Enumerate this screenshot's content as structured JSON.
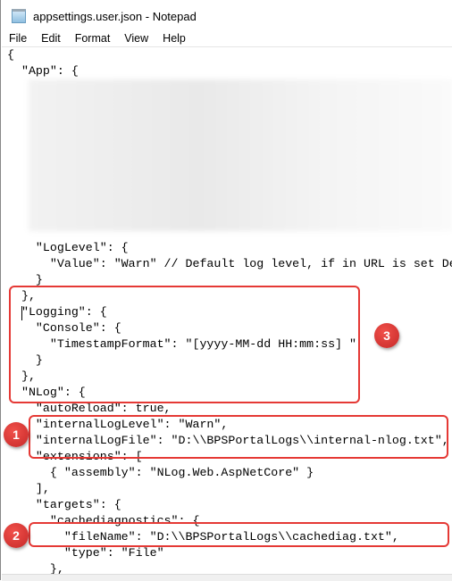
{
  "window": {
    "title": "appsettings.user.json - Notepad",
    "icon": "notepad-icon"
  },
  "menu": [
    "File",
    "Edit",
    "Format",
    "View",
    "Help"
  ],
  "lines": [
    "{",
    "  \"App\": {",
    "    \"LogLevel\": {",
    "      \"Value\": \"Warn\" // Default log level, if in URL is set De",
    "    }",
    "  },",
    "  \"Logging\": {",
    "    \"Console\": {",
    "      \"TimestampFormat\": \"[yyyy-MM-dd HH:mm:ss] \"",
    "    }",
    "  },",
    "  \"NLog\": {",
    "    \"autoReload\": true,",
    "    \"internalLogLevel\": \"Warn\",",
    "    \"internalLogFile\": \"D:\\\\BPSPortalLogs\\\\internal-nlog.txt\",",
    "    \"extensions\": [",
    "      { \"assembly\": \"NLog.Web.AspNetCore\" }",
    "    ],",
    "    \"targets\": {",
    "      \"cachediagnostics\": {",
    "        \"fileName\": \"D:\\\\BPSPortalLogs\\\\cachediag.txt\",",
    "        \"type\": \"File\"",
    "      },"
  ],
  "annotations": [
    "1",
    "2",
    "3"
  ],
  "annotation_color": "#e53935"
}
